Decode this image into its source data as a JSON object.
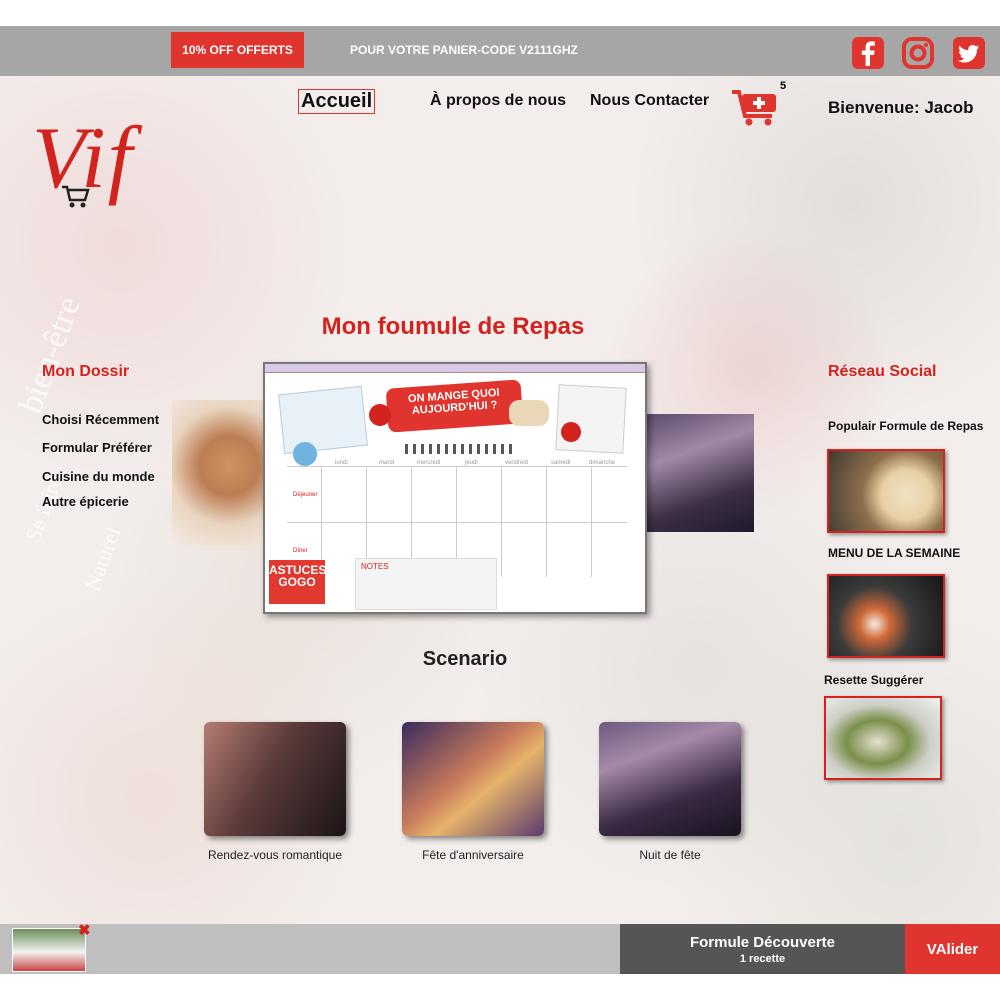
{
  "promo": {
    "badge": "10% OFF OFFERTS",
    "text": "POUR VOTRE PANIER-CODE V2111GHZ"
  },
  "nav": {
    "home": "Accueil",
    "about": "À propos de nous",
    "contact": "Nous Contacter",
    "cart_count": "5",
    "welcome": "Bienvenue: Jacob"
  },
  "logo": "Vif",
  "page_title": "Mon foumule de Repas",
  "left_sidebar": {
    "heading": "Mon Dossir",
    "items": [
      "Choisi Récemment",
      "Formular Préférer",
      "Cuisine du monde",
      "Autre épicerie"
    ]
  },
  "right_sidebar": {
    "heading": "Réseau Social",
    "sections": [
      "Populair Formule de Repas",
      "MENU DE LA SEMAINE",
      "Resette Suggérer"
    ]
  },
  "planner": {
    "title": "ON MANGE QUOI AUJOURD'HUI ?",
    "days": [
      "lundi",
      "mardi",
      "mercredi",
      "jeudi",
      "vendredi",
      "samedi",
      "dimanche"
    ],
    "rows": [
      "Déjeuner",
      "Dîner"
    ],
    "notes": "NOTES",
    "brand": "ASTUCES GOGO"
  },
  "scenario": {
    "title": "Scenario",
    "items": [
      "Rendez-vous romantique",
      "Fête d'anniversaire",
      "Nuit de fête"
    ]
  },
  "bottom": {
    "formule": "Formule Découverte",
    "recette": "1 recette",
    "valider": "VAlider"
  },
  "colors": {
    "accent": "#e0352e",
    "bar": "#a6a6a6",
    "dark": "#555555"
  },
  "icons": [
    "facebook-icon",
    "instagram-icon",
    "twitter-icon",
    "cart-icon",
    "close-icon"
  ]
}
